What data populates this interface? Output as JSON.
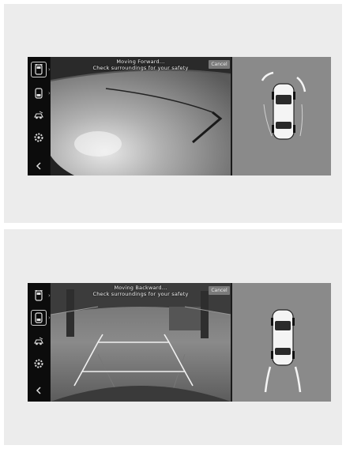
{
  "screens": [
    {
      "mode": "forward",
      "banner_line1": "Moving Forward...",
      "banner_line2": "Check surroundings for your safety",
      "cancel_label": "Cancel",
      "active_sidebar_item": 0
    },
    {
      "mode": "backward",
      "banner_line1": "Moving Backward...",
      "banner_line2": "Check surroundings for your safety",
      "cancel_label": "Cancel",
      "active_sidebar_item": 1
    }
  ],
  "sidebar_icons": [
    "front-view-icon",
    "rear-view-icon",
    "3d-view-icon",
    "settings-icon",
    "back-icon"
  ],
  "colors": {
    "panel_bg": "#ececec",
    "sidebar_bg": "#0c0c0c",
    "guide_line": "#f0f0f0",
    "topview_bg": "#8c8c8c"
  }
}
